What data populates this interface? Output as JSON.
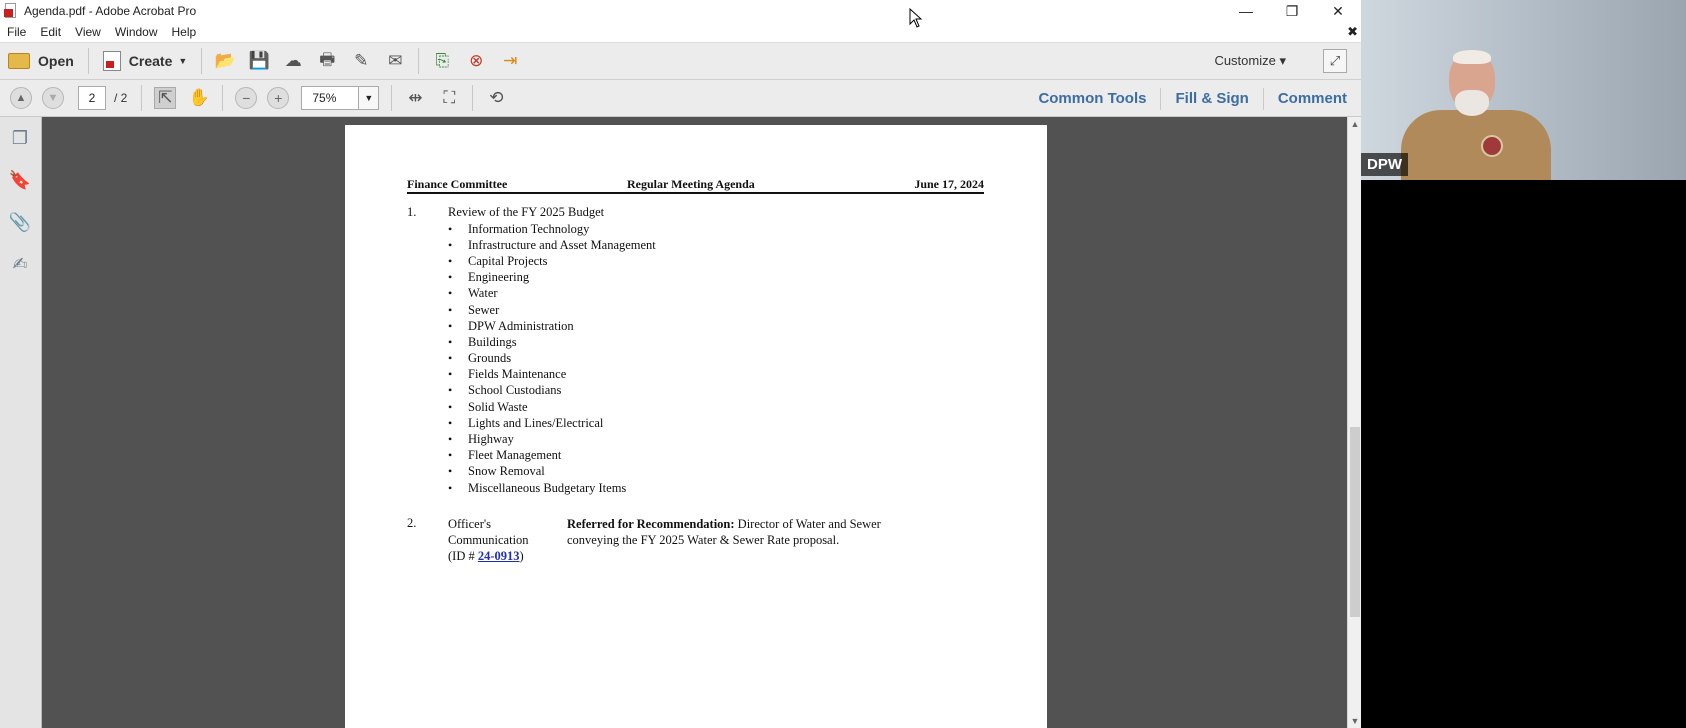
{
  "window": {
    "title": "Agenda.pdf - Adobe Acrobat Pro",
    "controls": {
      "minimize": "—",
      "restore": "❐",
      "close": "✕"
    }
  },
  "menu": [
    "File",
    "Edit",
    "View",
    "Window",
    "Help"
  ],
  "toolbar": {
    "open_label": "Open",
    "create_label": "Create",
    "customize_label": "Customize"
  },
  "navbar": {
    "current_page": "2",
    "total_pages": "/ 2",
    "zoom": "75%",
    "right_tools": [
      "Common Tools",
      "Fill & Sign",
      "Comment"
    ]
  },
  "document": {
    "header": {
      "left": "Finance Committee",
      "center": "Regular Meeting Agenda",
      "right": "June 17, 2024"
    },
    "item1": {
      "number": "1.",
      "title": "Review of the FY 2025 Budget",
      "bullets": [
        "Information Technology",
        "Infrastructure and Asset Management",
        "Capital Projects",
        "Engineering",
        "Water",
        "Sewer",
        "DPW Administration",
        "Buildings",
        "Grounds",
        "Fields Maintenance",
        "School Custodians",
        "Solid Waste",
        "Lights and Lines/Electrical",
        "Highway",
        "Fleet Management",
        "Snow Removal",
        "Miscellaneous Budgetary Items"
      ]
    },
    "item2": {
      "number": "2.",
      "officer_line1": "Officer's",
      "officer_line2": "Communication",
      "id_prefix": "(ID # ",
      "id_link": "24-0913",
      "id_suffix": ")",
      "referred_bold": "Referred for Recommendation:",
      "referred_text": " Director of Water and Sewer conveying the FY 2025 Water & Sewer Rate proposal."
    }
  },
  "video": {
    "label": "DPW"
  }
}
